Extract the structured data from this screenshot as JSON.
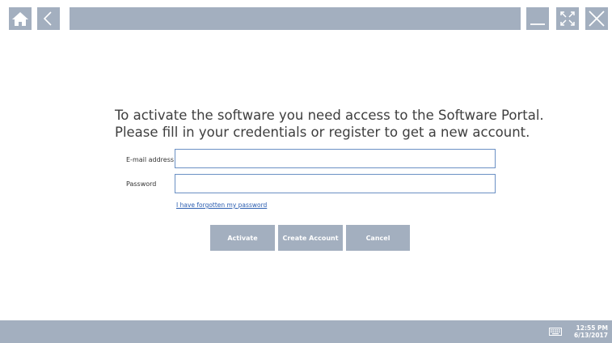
{
  "toolbar": {
    "buttons": [
      "home-icon",
      "back-icon",
      "minimize-icon",
      "fullscreen-icon",
      "close-icon"
    ],
    "strip_color": "#a3afbf"
  },
  "main": {
    "heading_line1": "To activate the software you need access to the Software Portal.",
    "heading_line2": "Please fill in your credentials or register to get a new account.",
    "email_label": "E-mail address",
    "email_value": "",
    "password_label": "Password",
    "password_value": "",
    "forgot_link": "I have forgotten my password",
    "buttons": {
      "activate": "Activate",
      "create_account": "Create Account",
      "cancel": "Cancel"
    }
  },
  "statusbar": {
    "keyboard_icon": "keyboard-icon",
    "time": "12:55 PM",
    "date": "6/13/2017"
  },
  "colors": {
    "accent": "#a3afbf",
    "input_border": "#6b90c4",
    "link": "#2a5db0",
    "text": "#3e3e3e"
  }
}
